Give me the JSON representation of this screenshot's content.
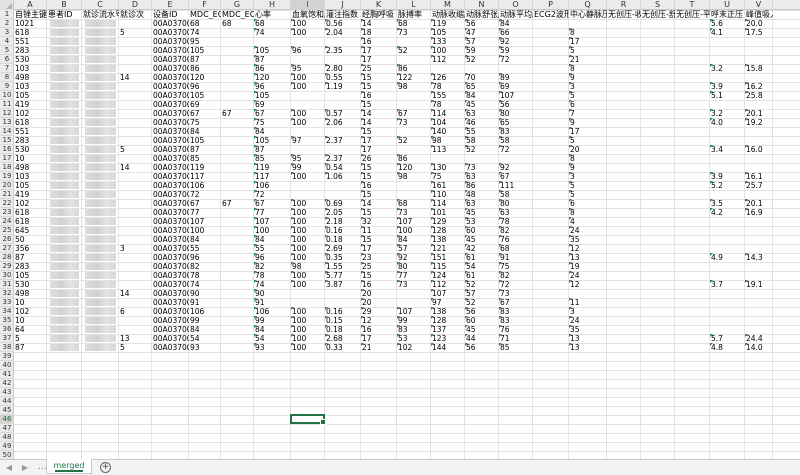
{
  "sheet": {
    "columns": [
      "A",
      "B",
      "C",
      "D",
      "E",
      "F",
      "G",
      "H",
      "I",
      "J",
      "K",
      "L",
      "M",
      "N",
      "O",
      "P",
      "Q",
      "R",
      "S",
      "T",
      "U",
      "V"
    ],
    "selected_column": "I",
    "selected_row": 46,
    "header_row": [
      "自锉主键",
      "患者ID",
      "就诊流水号",
      "就诊次",
      "设备ID",
      "MDC_ECG_",
      "MDC_ECG_",
      "心率",
      "血氧饱和度",
      "灌注指数",
      "经胸呼吸",
      "脉搏率",
      "动脉收缩压",
      "动脉舒张压",
      "动脉平均压",
      "ECG2波形",
      "中心静脉压",
      "无创压-收缩",
      "无创压-舒张",
      "无创压-平均",
      "呼末正压",
      "峰值吸入压"
    ],
    "rows": [
      [
        "1021",
        "",
        "",
        "",
        "00A03700",
        "68",
        "68",
        "68",
        "100",
        "0.56",
        "14",
        "68",
        "119",
        "56",
        "84",
        "",
        "",
        "",
        "",
        "",
        "5.6",
        "20.0",
        "17"
      ],
      [
        "618",
        "",
        "",
        "5",
        "00A03700",
        "74",
        "",
        "74",
        "100",
        "2.04",
        "18",
        "73",
        "105",
        "47",
        "66",
        "",
        "8",
        "",
        "",
        "",
        "4.1",
        "17.5",
        "16"
      ],
      [
        "551",
        "",
        "",
        "",
        "00A03700",
        "95",
        "",
        "",
        "",
        "",
        "16",
        "",
        "133",
        "57",
        "92",
        "",
        "17",
        "",
        "",
        "",
        "",
        "",
        ""
      ],
      [
        "283",
        "",
        "",
        "",
        "00A03700",
        "105",
        "",
        "105",
        "96",
        "2.35",
        "17",
        "52",
        "100",
        "59",
        "59",
        "",
        "5",
        "",
        "",
        "",
        "",
        "",
        ""
      ],
      [
        "530",
        "",
        "",
        "",
        "00A03700",
        "87",
        "",
        "87",
        "",
        "",
        "17",
        "",
        "112",
        "52",
        "72",
        "",
        "21",
        "",
        "",
        "",
        "",
        "",
        ""
      ],
      [
        "103",
        "",
        "",
        "",
        "00A03700",
        "86",
        "",
        "86",
        "95",
        "2.80",
        "25",
        "86",
        "",
        "",
        "",
        "",
        "8",
        "",
        "",
        "",
        "3.2",
        "15.8",
        "11"
      ],
      [
        "498",
        "",
        "",
        "14",
        "00A03700",
        "120",
        "",
        "120",
        "100",
        "0.55",
        "15",
        "122",
        "126",
        "70",
        "89",
        "",
        "9",
        "",
        "",
        "",
        "",
        "",
        ""
      ],
      [
        "103",
        "",
        "",
        "",
        "00A03700",
        "96",
        "",
        "96",
        "100",
        "1.19",
        "15",
        "98",
        "78",
        "65",
        "69",
        "",
        "3",
        "",
        "",
        "",
        "3.9",
        "16.2",
        "15"
      ],
      [
        "105",
        "",
        "",
        "",
        "00A03700",
        "105",
        "",
        "105",
        "",
        "",
        "16",
        "",
        "155",
        "84",
        "107",
        "",
        "5",
        "",
        "",
        "",
        "5.1",
        "25.8",
        "25"
      ],
      [
        "419",
        "",
        "",
        "",
        "00A03700",
        "69",
        "",
        "69",
        "",
        "",
        "15",
        "",
        "78",
        "45",
        "56",
        "",
        "6",
        "",
        "",
        "",
        "",
        "",
        ""
      ],
      [
        "102",
        "",
        "",
        "",
        "00A03700",
        "67",
        "67",
        "67",
        "100",
        "0.57",
        "14",
        "67",
        "114",
        "63",
        "80",
        "",
        "7",
        "",
        "",
        "",
        "3.2",
        "20.1",
        "18"
      ],
      [
        "618",
        "",
        "",
        "",
        "00A03700",
        "75",
        "",
        "75",
        "100",
        "2.06",
        "14",
        "73",
        "104",
        "46",
        "65",
        "",
        "9",
        "",
        "",
        "",
        "4.0",
        "19.2",
        "18"
      ],
      [
        "551",
        "",
        "",
        "",
        "00A03700",
        "84",
        "",
        "84",
        "",
        "",
        "15",
        "",
        "140",
        "55",
        "83",
        "",
        "17",
        "",
        "",
        "",
        "",
        "",
        ""
      ],
      [
        "283",
        "",
        "",
        "",
        "00A03700",
        "105",
        "",
        "105",
        "97",
        "2.37",
        "17",
        "52",
        "98",
        "58",
        "58",
        "",
        "5",
        "",
        "",
        "",
        "",
        "",
        ""
      ],
      [
        "530",
        "",
        "",
        "5",
        "00A03700",
        "87",
        "",
        "87",
        "",
        "",
        "17",
        "",
        "113",
        "52",
        "72",
        "",
        "20",
        "",
        "",
        "",
        "3.4",
        "16.0",
        "12"
      ],
      [
        "10",
        "",
        "",
        "",
        "00A03700",
        "85",
        "",
        "85",
        "95",
        "2.37",
        "26",
        "86",
        "",
        "",
        "",
        "",
        "8",
        "",
        "",
        "",
        "",
        "",
        ""
      ],
      [
        "498",
        "",
        "",
        "14",
        "00A03700",
        "119",
        "",
        "119",
        "99",
        "0.54",
        "15",
        "120",
        "130",
        "73",
        "92",
        "",
        "9",
        "",
        "",
        "",
        "",
        "",
        ""
      ],
      [
        "103",
        "",
        "",
        "",
        "00A03700",
        "117",
        "",
        "117",
        "100",
        "1.06",
        "15",
        "98",
        "75",
        "63",
        "67",
        "",
        "3",
        "",
        "",
        "",
        "3.9",
        "16.1",
        "15"
      ],
      [
        "105",
        "",
        "",
        "",
        "00A03700",
        "106",
        "",
        "106",
        "",
        "",
        "16",
        "",
        "161",
        "86",
        "111",
        "",
        "5",
        "",
        "",
        "",
        "5.2",
        "25.7",
        "25"
      ],
      [
        "419",
        "",
        "",
        "",
        "00A03700",
        "72",
        "",
        "72",
        "",
        "",
        "15",
        "",
        "110",
        "48",
        "58",
        "",
        "5",
        "",
        "",
        "",
        "",
        "",
        ""
      ],
      [
        "102",
        "",
        "",
        "",
        "00A03700",
        "67",
        "67",
        "67",
        "100",
        "0.69",
        "14",
        "68",
        "114",
        "63",
        "80",
        "",
        "6",
        "",
        "",
        "",
        "3.5",
        "20.1",
        "18"
      ],
      [
        "618",
        "",
        "",
        "",
        "00A03700",
        "77",
        "",
        "77",
        "100",
        "2.05",
        "15",
        "73",
        "101",
        "45",
        "63",
        "",
        "8",
        "",
        "",
        "",
        "4.2",
        "16.9",
        "16"
      ],
      [
        "618",
        "",
        "",
        "",
        "00A03700",
        "107",
        "",
        "107",
        "100",
        "2.18",
        "32",
        "107",
        "129",
        "53",
        "78",
        "",
        "4",
        "",
        "",
        "",
        "",
        "",
        ""
      ],
      [
        "645",
        "",
        "",
        "",
        "00A03700",
        "100",
        "",
        "100",
        "100",
        "0.16",
        "11",
        "100",
        "128",
        "60",
        "82",
        "",
        "24",
        "",
        "",
        "",
        "",
        "",
        ""
      ],
      [
        "50",
        "",
        "",
        "",
        "00A03700",
        "84",
        "",
        "84",
        "100",
        "0.18",
        "15",
        "84",
        "138",
        "45",
        "76",
        "",
        "35",
        "",
        "",
        "",
        "",
        "",
        ""
      ],
      [
        "356",
        "",
        "",
        "3",
        "00A03700",
        "55",
        "",
        "55",
        "100",
        "2.69",
        "17",
        "57",
        "121",
        "42",
        "68",
        "",
        "12",
        "",
        "",
        "",
        "",
        "",
        ""
      ],
      [
        "87",
        "",
        "",
        "",
        "00A03700",
        "96",
        "",
        "96",
        "100",
        "0.35",
        "23",
        "92",
        "151",
        "61",
        "91",
        "",
        "13",
        "",
        "",
        "",
        "4.9",
        "14.3",
        "11"
      ],
      [
        "283",
        "",
        "",
        "",
        "00A03700",
        "82",
        "",
        "82",
        "98",
        "1.55",
        "25",
        "80",
        "115",
        "54",
        "75",
        "",
        "19",
        "",
        "",
        "",
        "",
        "",
        ""
      ],
      [
        "105",
        "",
        "",
        "",
        "00A03700",
        "78",
        "",
        "78",
        "100",
        "5.77",
        "15",
        "77",
        "124",
        "61",
        "82",
        "",
        "24",
        "",
        "",
        "",
        "",
        "",
        ""
      ],
      [
        "530",
        "",
        "",
        "",
        "00A03700",
        "74",
        "",
        "74",
        "100",
        "3.87",
        "16",
        "73",
        "112",
        "52",
        "72",
        "",
        "12",
        "",
        "",
        "",
        "3.7",
        "19.1",
        "14"
      ],
      [
        "498",
        "",
        "",
        "14",
        "00A03700",
        "90",
        "",
        "90",
        "",
        "",
        "20",
        "",
        "107",
        "57",
        "73",
        "",
        "",
        "",
        "",
        "",
        "",
        "",
        ""
      ],
      [
        "10",
        "",
        "",
        "",
        "00A03700",
        "91",
        "",
        "91",
        "",
        "",
        "20",
        "",
        "97",
        "52",
        "67",
        "",
        "11",
        "",
        "",
        "",
        "",
        "",
        ""
      ],
      [
        "102",
        "",
        "",
        "6",
        "00A03700",
        "106",
        "",
        "106",
        "100",
        "0.16",
        "29",
        "107",
        "138",
        "56",
        "83",
        "",
        "3",
        "",
        "",
        "",
        "",
        "",
        ""
      ],
      [
        "10",
        "",
        "",
        "",
        "00A03700",
        "99",
        "",
        "99",
        "100",
        "0.15",
        "12",
        "99",
        "128",
        "60",
        "83",
        "",
        "24",
        "",
        "",
        "",
        "",
        "",
        ""
      ],
      [
        "64",
        "",
        "",
        "",
        "00A03700",
        "84",
        "",
        "84",
        "100",
        "0.18",
        "16",
        "83",
        "137",
        "45",
        "76",
        "",
        "35",
        "",
        "",
        "",
        "",
        "",
        ""
      ],
      [
        "5",
        "",
        "",
        "13",
        "00A03700",
        "54",
        "",
        "54",
        "100",
        "2.68",
        "17",
        "53",
        "123",
        "44",
        "71",
        "",
        "13",
        "",
        "",
        "",
        "5.7",
        "24.4",
        "24"
      ],
      [
        "87",
        "",
        "",
        "5",
        "00A03700",
        "93",
        "",
        "93",
        "100",
        "0.33",
        "21",
        "102",
        "144",
        "56",
        "85",
        "",
        "13",
        "",
        "",
        "",
        "4.8",
        "14.0",
        "12"
      ]
    ]
  },
  "tabs": {
    "sheet_name": "merged",
    "add_label": "+",
    "more_label": "...",
    "prev_label": "◀",
    "next_label": "▶"
  }
}
